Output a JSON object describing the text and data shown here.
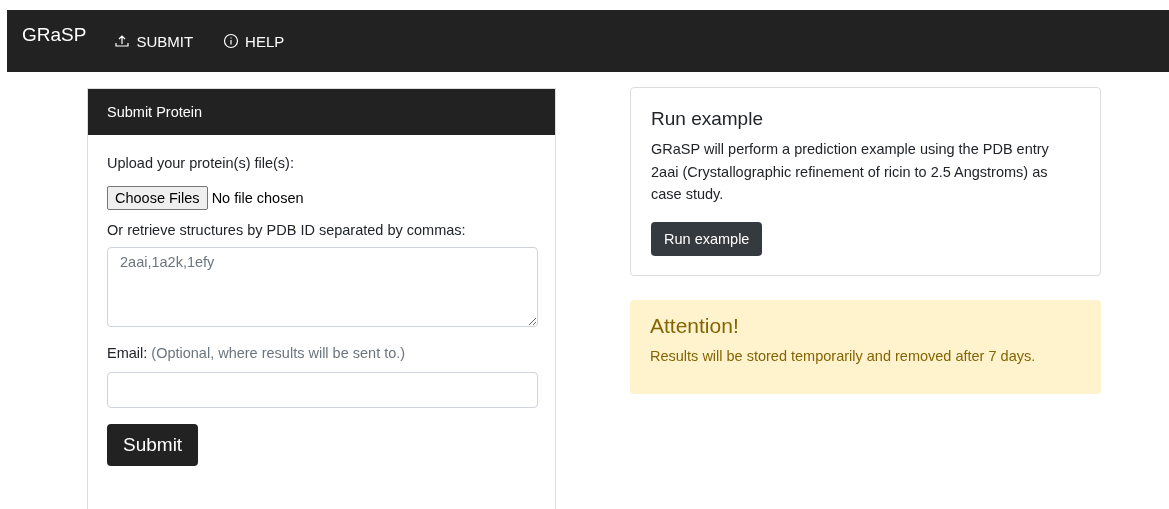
{
  "navbar": {
    "brand": "GRaSP",
    "links": [
      {
        "kind": "upload",
        "label": "SUBMIT"
      },
      {
        "kind": "info",
        "label": "HELP"
      }
    ]
  },
  "submit_card": {
    "title": "Submit Protein",
    "upload_label": "Upload your protein(s) file(s):",
    "file_button": "Choose Files",
    "file_status": "No file chosen",
    "pdb_label": "Or retrieve structures by PDB ID separated by commas:",
    "pdb_field": {
      "placeholder": "2aai,1a2k,1efy"
    },
    "email_label": "Email:",
    "email_hint": "(Optional, where results will be sent to.)",
    "submit_button": "Submit"
  },
  "example_card": {
    "title": "Run example",
    "text": "GRaSP will perform a prediction example using the PDB entry 2aai (Crystallographic refinement of ricin to 2.5 Angstroms) as case study.",
    "button": "Run example"
  },
  "alert": {
    "title": "Attention!",
    "text": "Results will be stored temporarily and removed after 7 days."
  }
}
